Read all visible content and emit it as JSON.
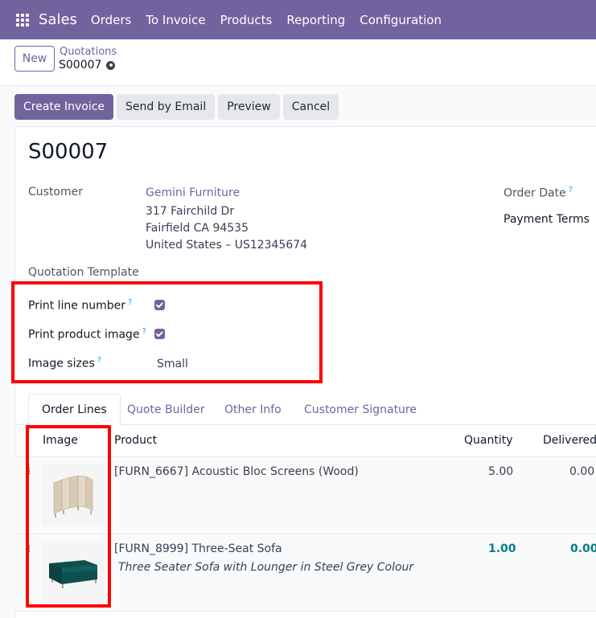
{
  "topbar": {
    "app_name": "Sales",
    "menu": [
      "Orders",
      "To Invoice",
      "Products",
      "Reporting",
      "Configuration"
    ]
  },
  "control": {
    "new_label": "New",
    "breadcrumb_parent": "Quotations",
    "breadcrumb_current": "S00007"
  },
  "actions": {
    "create_invoice": "Create Invoice",
    "send_email": "Send by Email",
    "preview": "Preview",
    "cancel": "Cancel"
  },
  "record": {
    "title": "S00007",
    "customer_label": "Customer",
    "customer_name": "Gemini Furniture",
    "address_line1": "317 Fairchild Dr",
    "address_line2": "Fairfield CA 94535",
    "address_line3": "United States – US12345674",
    "order_date_label": "Order Date",
    "payment_terms_label": "Payment Terms",
    "quotation_template_label": "Quotation Template",
    "print_line_number_label": "Print line number",
    "print_product_image_label": "Print product image",
    "image_sizes_label": "Image sizes",
    "image_sizes_value": "Small",
    "help_mark": "?"
  },
  "tabs": [
    "Order Lines",
    "Quote Builder",
    "Other Info",
    "Customer Signature"
  ],
  "table": {
    "headers": {
      "image": "Image",
      "product": "Product",
      "quantity": "Quantity",
      "delivered": "Delivered"
    },
    "rows": [
      {
        "product": "[FURN_6667] Acoustic Bloc Screens (Wood)",
        "description": "",
        "quantity": "5.00",
        "delivered": "0.00"
      },
      {
        "product": "[FURN_8999] Three-Seat Sofa",
        "description": "Three Seater Sofa with Lounger in Steel Grey Colour",
        "quantity": "1.00",
        "delivered": "0.00"
      }
    ]
  },
  "colors": {
    "brand": "#71639e",
    "highlight": "#ff0000",
    "qty_accent": "#017e84"
  }
}
